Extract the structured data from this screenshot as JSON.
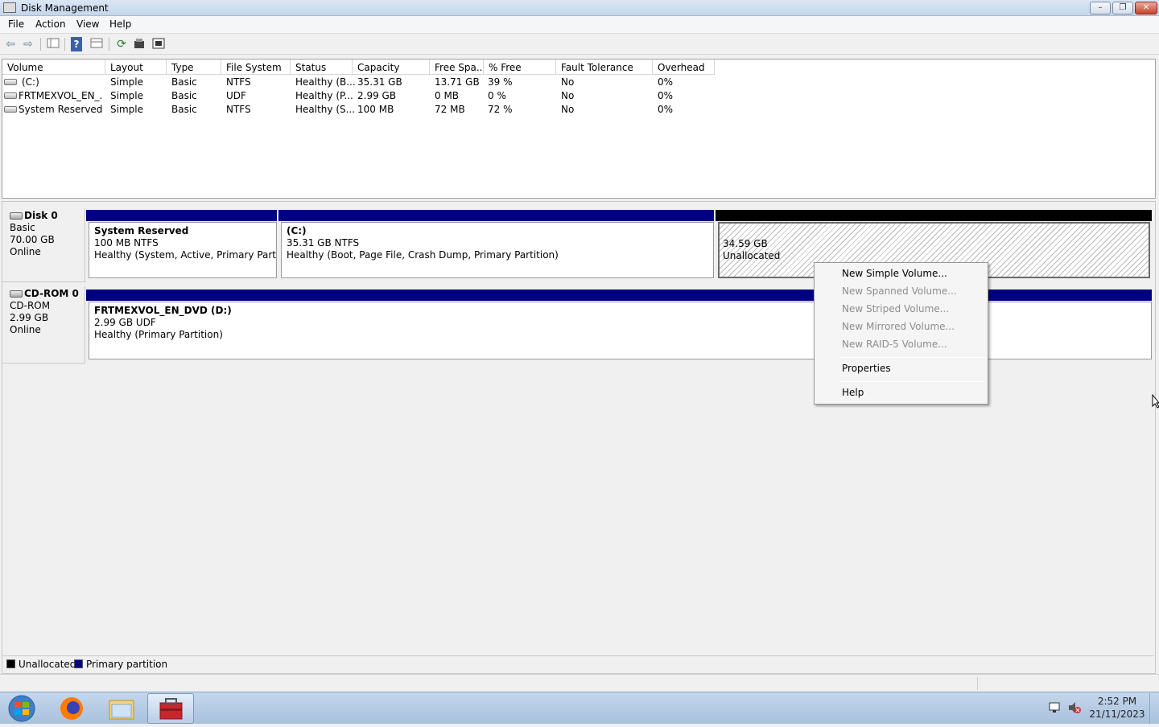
{
  "window": {
    "title": "Disk Management",
    "minimize": "–",
    "maximize": "❐",
    "close": "✕"
  },
  "menu": {
    "file": "File",
    "action": "Action",
    "view": "View",
    "help": "Help"
  },
  "toolbar": {
    "back": "⇦",
    "forward": "⇨",
    "help": "?",
    "refresh": "⟳"
  },
  "columns": [
    "Volume",
    "Layout",
    "Type",
    "File System",
    "Status",
    "Capacity",
    "Free Spa...",
    "% Free",
    "Fault Tolerance",
    "Overhead"
  ],
  "volumes": [
    {
      "volume": "(C:)",
      "layout": "Simple",
      "type": "Basic",
      "fs": "NTFS",
      "status": "Healthy (B...",
      "capacity": "35.31 GB",
      "free": "13.71 GB",
      "pct": "39 %",
      "fault": "No",
      "overhead": "0%"
    },
    {
      "volume": "FRTMEXVOL_EN_...",
      "layout": "Simple",
      "type": "Basic",
      "fs": "UDF",
      "status": "Healthy (P...",
      "capacity": "2.99 GB",
      "free": "0 MB",
      "pct": "0 %",
      "fault": "No",
      "overhead": "0%"
    },
    {
      "volume": "System Reserved",
      "layout": "Simple",
      "type": "Basic",
      "fs": "NTFS",
      "status": "Healthy (S...",
      "capacity": "100 MB",
      "free": "72 MB",
      "pct": "72 %",
      "fault": "No",
      "overhead": "0%"
    }
  ],
  "disks": [
    {
      "name": "Disk 0",
      "type": "Basic",
      "size": "70.00 GB",
      "state": "Online",
      "partitions": [
        {
          "title": "System Reserved",
          "size": "100 MB NTFS",
          "status": "Healthy (System, Active, Primary Partition)"
        },
        {
          "title": "(C:)",
          "size": "35.31 GB NTFS",
          "status": "Healthy (Boot, Page File, Crash Dump, Primary Partition)"
        },
        {
          "title": "",
          "size": "34.59 GB",
          "status": "Unallocated"
        }
      ]
    },
    {
      "name": "CD-ROM 0",
      "type": "CD-ROM",
      "size": "2.99 GB",
      "state": "Online",
      "partitions": [
        {
          "title": "FRTMEXVOL_EN_DVD  (D:)",
          "size": "2.99 GB UDF",
          "status": "Healthy (Primary Partition)"
        }
      ]
    }
  ],
  "legend": {
    "unallocated": "Unallocated",
    "primary": "Primary partition"
  },
  "colors": {
    "primary": "#000080",
    "unallocated": "#000000"
  },
  "context_menu": [
    {
      "label": "New Simple Volume...",
      "enabled": true
    },
    {
      "label": "New Spanned Volume...",
      "enabled": false
    },
    {
      "label": "New Striped Volume...",
      "enabled": false
    },
    {
      "label": "New Mirrored Volume...",
      "enabled": false
    },
    {
      "label": "New RAID-5 Volume...",
      "enabled": false
    },
    {
      "label": "Properties",
      "enabled": true
    },
    {
      "label": "Help",
      "enabled": true
    }
  ],
  "clock": {
    "time": "2:52 PM",
    "date": "21/11/2023"
  }
}
